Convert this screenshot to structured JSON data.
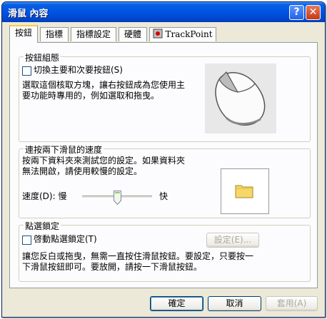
{
  "window": {
    "title": "滑鼠 內容",
    "help_glyph": "?",
    "close_glyph": "✕"
  },
  "tabs": [
    {
      "label": "按鈕",
      "active": true
    },
    {
      "label": "指標",
      "active": false
    },
    {
      "label": "指標設定",
      "active": false
    },
    {
      "label": "硬體",
      "active": false
    },
    {
      "label": "TrackPoint",
      "active": false
    }
  ],
  "button_config": {
    "legend": "按鈕組態",
    "swap_checkbox_label": "切換主要和次要按鈕(S)",
    "swap_checked": false,
    "description_line1": "選取這個核取方塊，讓右按鈕成為您使用主",
    "description_line2": "要功能時專用的，例如選取和拖曳。"
  },
  "double_click": {
    "legend": "連按兩下滑鼠的速度",
    "description_line1": "按兩下資料夾來測試您的設定。如果資料夾",
    "description_line2": "無法開啟，請使用較慢的設定。",
    "speed_label": "速度(D): 慢",
    "fast_label": "快",
    "speed_value": 0.5
  },
  "clicklock": {
    "legend": "點選鎖定",
    "checkbox_label": "啓動點選鎖定(T)",
    "checked": false,
    "settings_button": "設定(E)...",
    "description_line1": "讓您反白或拖曳，無需一直按住滑鼠按鈕。要設定，只要按一",
    "description_line2": "下滑鼠按鈕即可。要放開，請按一下滑鼠按鈕。"
  },
  "footer": {
    "ok": "確定",
    "cancel": "取消",
    "apply": "套用(A)"
  },
  "colors": {
    "titlebar": "#0054e3",
    "dialog_bg": "#ece9d8",
    "tab_highlight": "#ffc83c",
    "folder": "#f5d76a"
  }
}
